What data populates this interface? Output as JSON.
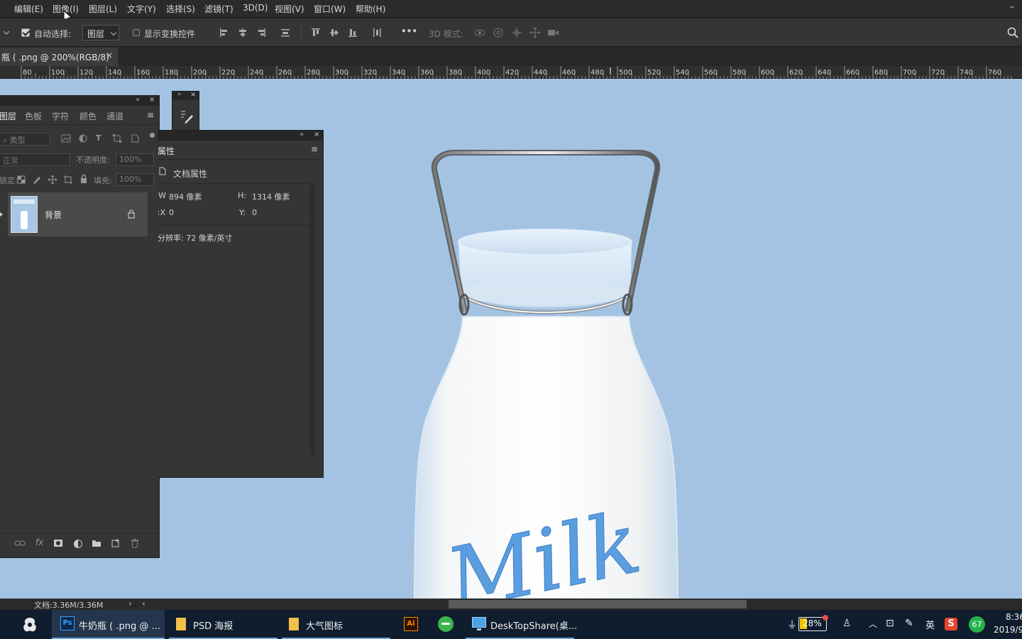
{
  "menubar": {
    "items": [
      "编辑(E)",
      "图像(I)",
      "图层(L)",
      "文字(Y)",
      "选择(S)",
      "滤镜(T)",
      "3D(D)",
      "视图(V)",
      "窗口(W)",
      "帮助(H)"
    ]
  },
  "options": {
    "auto_select_label": "自动选择:",
    "auto_select_checked": true,
    "auto_select_target": "图层",
    "show_transform_label": "显示变换控件",
    "show_transform_checked": false,
    "mode_3d_label": "3D 模式:",
    "more_label": "•••"
  },
  "document": {
    "tab_label": "瓶 ( .png @ 200%(RGB/8)",
    "close_label": "×"
  },
  "ruler": {
    "ticks": [
      "80",
      "100",
      "120",
      "140",
      "160",
      "180",
      "200",
      "220",
      "240",
      "260",
      "280",
      "300",
      "320",
      "340",
      "360",
      "380",
      "400",
      "420",
      "440",
      "460",
      "480",
      "500",
      "520",
      "540",
      "560",
      "580",
      "600",
      "620",
      "640",
      "660",
      "680",
      "700",
      "720",
      "740",
      "760"
    ]
  },
  "canvas": {
    "label_text": "Milk",
    "background_color": "#a4c3e3"
  },
  "layers_panel": {
    "tabs": [
      "图层",
      "色板",
      "字符",
      "颜色",
      "通道"
    ],
    "filter_label": "类型",
    "blend_mode": "正常",
    "opacity_label": "不透明度:",
    "opacity_value": "100%",
    "lock_label": "锁定:",
    "fill_label": "填充:",
    "fill_value": "100%",
    "layer_name": "背景"
  },
  "properties_panel": {
    "title": "属性",
    "section": "文档属性",
    "w_label": "W:",
    "w_value": "894 像素",
    "h_label": "H:",
    "h_value": "1314 像素",
    "x_label": "X:",
    "x_value": "0",
    "y_label": "Y:",
    "y_value": "0",
    "resolution": "分辨率: 72 像素/英寸"
  },
  "status": {
    "doc_size": "文档:3.36M/3.36M"
  },
  "taskbar": {
    "items": [
      {
        "label": "牛奶瓶 ( .png @ ...",
        "icon": "photoshop-icon"
      },
      {
        "label": "PSD 海报",
        "icon": "folder-icon"
      },
      {
        "label": "大气图标",
        "icon": "folder-icon"
      },
      {
        "label": "",
        "icon": "illustrator-icon"
      },
      {
        "label": "",
        "icon": "browser-icon"
      },
      {
        "label": "DeskTopShare(桌...",
        "icon": "monitor-icon"
      }
    ],
    "battery": "28%",
    "ime": "英",
    "badge": "67",
    "time": "8:36",
    "date": "2019/9"
  }
}
